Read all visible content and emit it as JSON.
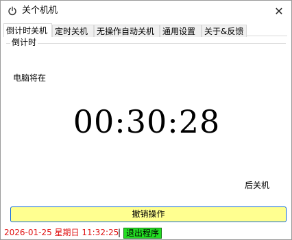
{
  "window": {
    "title": "关个机机",
    "close_glyph": "✕",
    "icon": "power-icon"
  },
  "tabs": [
    {
      "label": "倒计时关机",
      "active": true
    },
    {
      "label": "定时关机",
      "active": false
    },
    {
      "label": "无操作自动关机",
      "active": false
    },
    {
      "label": "通用设置",
      "active": false
    },
    {
      "label": "关于&反馈",
      "active": false
    }
  ],
  "countdown_panel": {
    "group_label": "倒计时",
    "prefix_text": "电脑将在",
    "time": "00:30:28",
    "suffix_text": "后关机",
    "cancel_label": "撤销操作"
  },
  "status_bar": {
    "datetime": "2026-01-25 星期日 11:32:25",
    "separator": "|",
    "exit_label": "退出程序"
  },
  "colors": {
    "cancel_bg": "#ffff90",
    "cancel_border": "#0a64d6",
    "datetime_color": "#e01010",
    "exit_bg": "#22dd22"
  }
}
